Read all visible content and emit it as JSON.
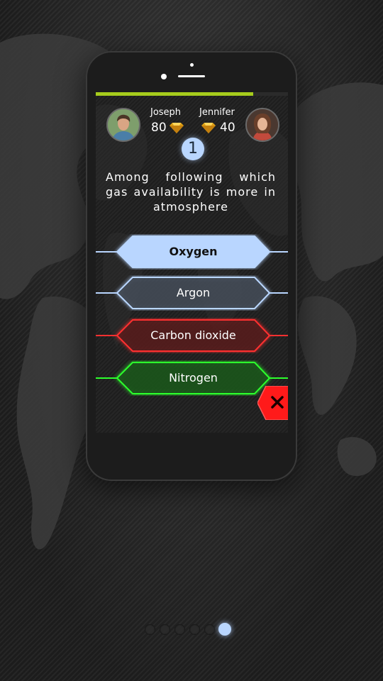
{
  "players": {
    "left": {
      "name": "Joseph",
      "score": "80"
    },
    "right": {
      "name": "Jennifer",
      "score": "40"
    }
  },
  "timer": {
    "remaining_fraction": 0.82,
    "color": "#a6cc1c"
  },
  "question": {
    "number": "1",
    "text": "Among following which gas availability is more in atmosphere"
  },
  "options": [
    {
      "label": "Oxygen",
      "state": "selected",
      "color": "#b9d6ff"
    },
    {
      "label": "Argon",
      "state": "neutral",
      "color": "#b9d6ff"
    },
    {
      "label": "Carbon dioxide",
      "state": "wrong",
      "color": "#ff3030"
    },
    {
      "label": "Nitrogen",
      "state": "correct",
      "color": "#2cff2c"
    }
  ],
  "close_button": {
    "icon": "close-icon",
    "color": "#ff1a1a"
  },
  "pager": {
    "count": 6,
    "active_index": 5
  }
}
